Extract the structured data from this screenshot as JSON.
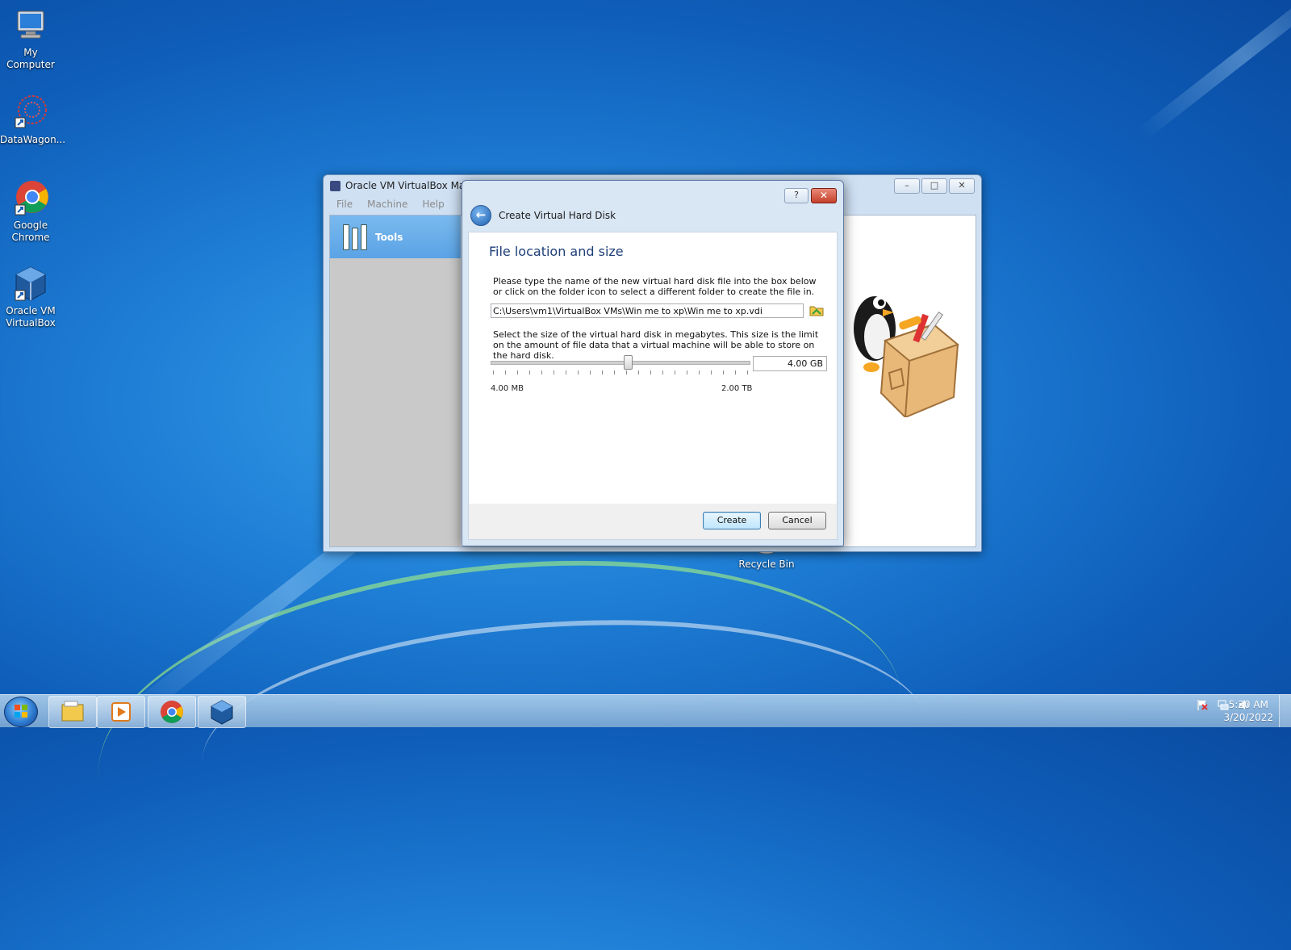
{
  "desktop": {
    "icons": [
      {
        "label": "My Computer",
        "icon": "computer-icon"
      },
      {
        "label": "DataWagon...",
        "icon": "datawagon-icon"
      },
      {
        "label": "Google Chrome",
        "icon": "chrome-icon"
      },
      {
        "label": "Oracle VM VirtualBox",
        "icon": "virtualbox-icon"
      },
      {
        "label": "Recycle Bin",
        "icon": "recycle-bin-icon"
      }
    ]
  },
  "vbox_window": {
    "title": "Oracle VM VirtualBox Mana",
    "menu": [
      "File",
      "Machine",
      "Help"
    ],
    "tools_label": "Tools",
    "caption_buttons": {
      "minimize": "–",
      "maximize": "□",
      "close": "✕"
    }
  },
  "dialog": {
    "header": "Create Virtual Hard Disk",
    "help_label": "?",
    "close_label": "✕",
    "back_label": "←",
    "section_title": "File location and size",
    "location_text": "Please type the name of the new virtual hard disk file into the box below or click on the folder icon to select a different folder to create the file in.",
    "file_path": "C:\\Users\\vm1\\VirtualBox VMs\\Win me to xp\\Win me to xp.vdi",
    "size_text": "Select the size of the virtual hard disk in megabytes. This size is the limit on the amount of file data that a virtual machine will be able to store on the hard disk.",
    "size_value": "4.00 GB",
    "slider_min_label": "4.00 MB",
    "slider_max_label": "2.00 TB",
    "slider_position": 0.53,
    "create_label": "Create",
    "cancel_label": "Cancel"
  },
  "taskbar": {
    "pinned": [
      "explorer-icon",
      "media-player-icon",
      "chrome-icon",
      "virtualbox-icon"
    ],
    "clock_time": "5:20 AM",
    "clock_date": "3/20/2022"
  },
  "colors": {
    "desktop_blue": "#1f7fd6",
    "dialog_title_blue": "#1e3f78",
    "close_red": "#c5402b"
  }
}
